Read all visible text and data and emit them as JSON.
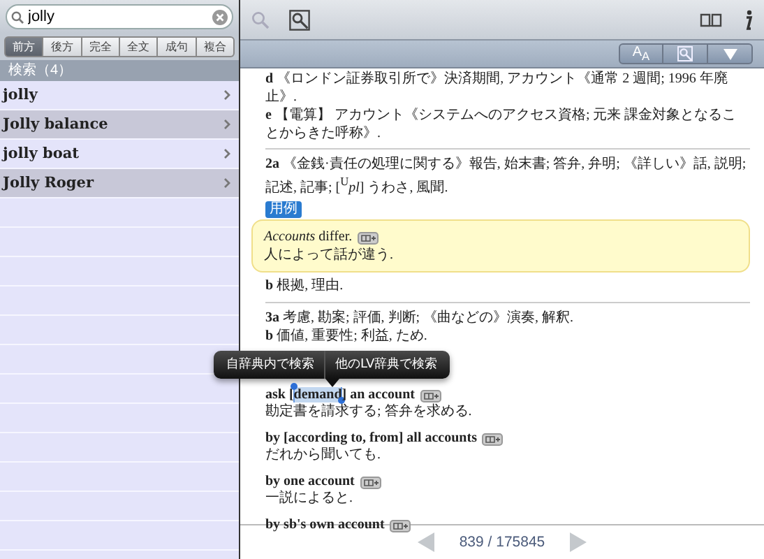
{
  "search": {
    "value": "jolly"
  },
  "filters": [
    {
      "label": "前方",
      "selected": true
    },
    {
      "label": "後方",
      "selected": false
    },
    {
      "label": "完全",
      "selected": false
    },
    {
      "label": "全文",
      "selected": false
    },
    {
      "label": "成句",
      "selected": false
    },
    {
      "label": "複合",
      "selected": false
    }
  ],
  "results_header": "検索（4）",
  "results": [
    {
      "label": "jolly"
    },
    {
      "label": "Jolly balance"
    },
    {
      "label": "jolly boat"
    },
    {
      "label": "Jolly Roger"
    }
  ],
  "font_button": "A$_{A}$",
  "entry": [
    {
      "kind": "sense",
      "mark": "d",
      "text": "《ロンドン証券取引所で》決済期間, アカウント《通常 2 週間; 1996 年廃止》."
    },
    {
      "kind": "sense",
      "mark": "e",
      "text": "【電算】 アカウント《システムへのアクセス資格; 元来 課金対象となることからきた呼称》."
    },
    {
      "kind": "divider"
    },
    {
      "kind": "sense",
      "mark": "2a",
      "text": "《金銭·責任の処理に関する》報告, 始末書; 答弁, 弁明; 《詳しい》話, 説明; 記述, 記事; [$^{U}$*pl*] うわさ, 風聞."
    },
    {
      "kind": "tag",
      "text": "用例"
    },
    {
      "kind": "example",
      "english": "*Accounts* differ.",
      "japanese": "人によって話が違う."
    },
    {
      "kind": "sense",
      "mark": "b",
      "text": "根拠, 理由."
    },
    {
      "kind": "divider"
    },
    {
      "kind": "sense",
      "mark": "3a",
      "text": "考慮, 勘案; 評価, 判断; 《曲などの》演奏, 解釈."
    },
    {
      "kind": "sense",
      "mark": "b",
      "text": "価値, 重要性; 利益, ため."
    },
    {
      "kind": "popup",
      "buttons": [
        "自辞典内で検索",
        "他のLV辞典で検索"
      ]
    },
    {
      "kind": "phrase",
      "parts": [
        {
          "text": "ask [",
          "selected": false
        },
        {
          "text": "demand",
          "selected": true
        },
        {
          "text": "] an account",
          "selected": false
        }
      ],
      "translation": "勘定書を請求する; 答弁を求める."
    },
    {
      "kind": "phrase",
      "parts": [
        {
          "text": "by [according to, from] all accounts",
          "selected": false
        }
      ],
      "translation": "だれから聞いても."
    },
    {
      "kind": "phrase",
      "parts": [
        {
          "text": "by one account",
          "selected": false
        }
      ],
      "translation": "一説によると."
    },
    {
      "kind": "phrase",
      "parts": [
        {
          "text": "by sb's own account",
          "selected": false
        }
      ]
    }
  ],
  "page": "839 / 175845"
}
